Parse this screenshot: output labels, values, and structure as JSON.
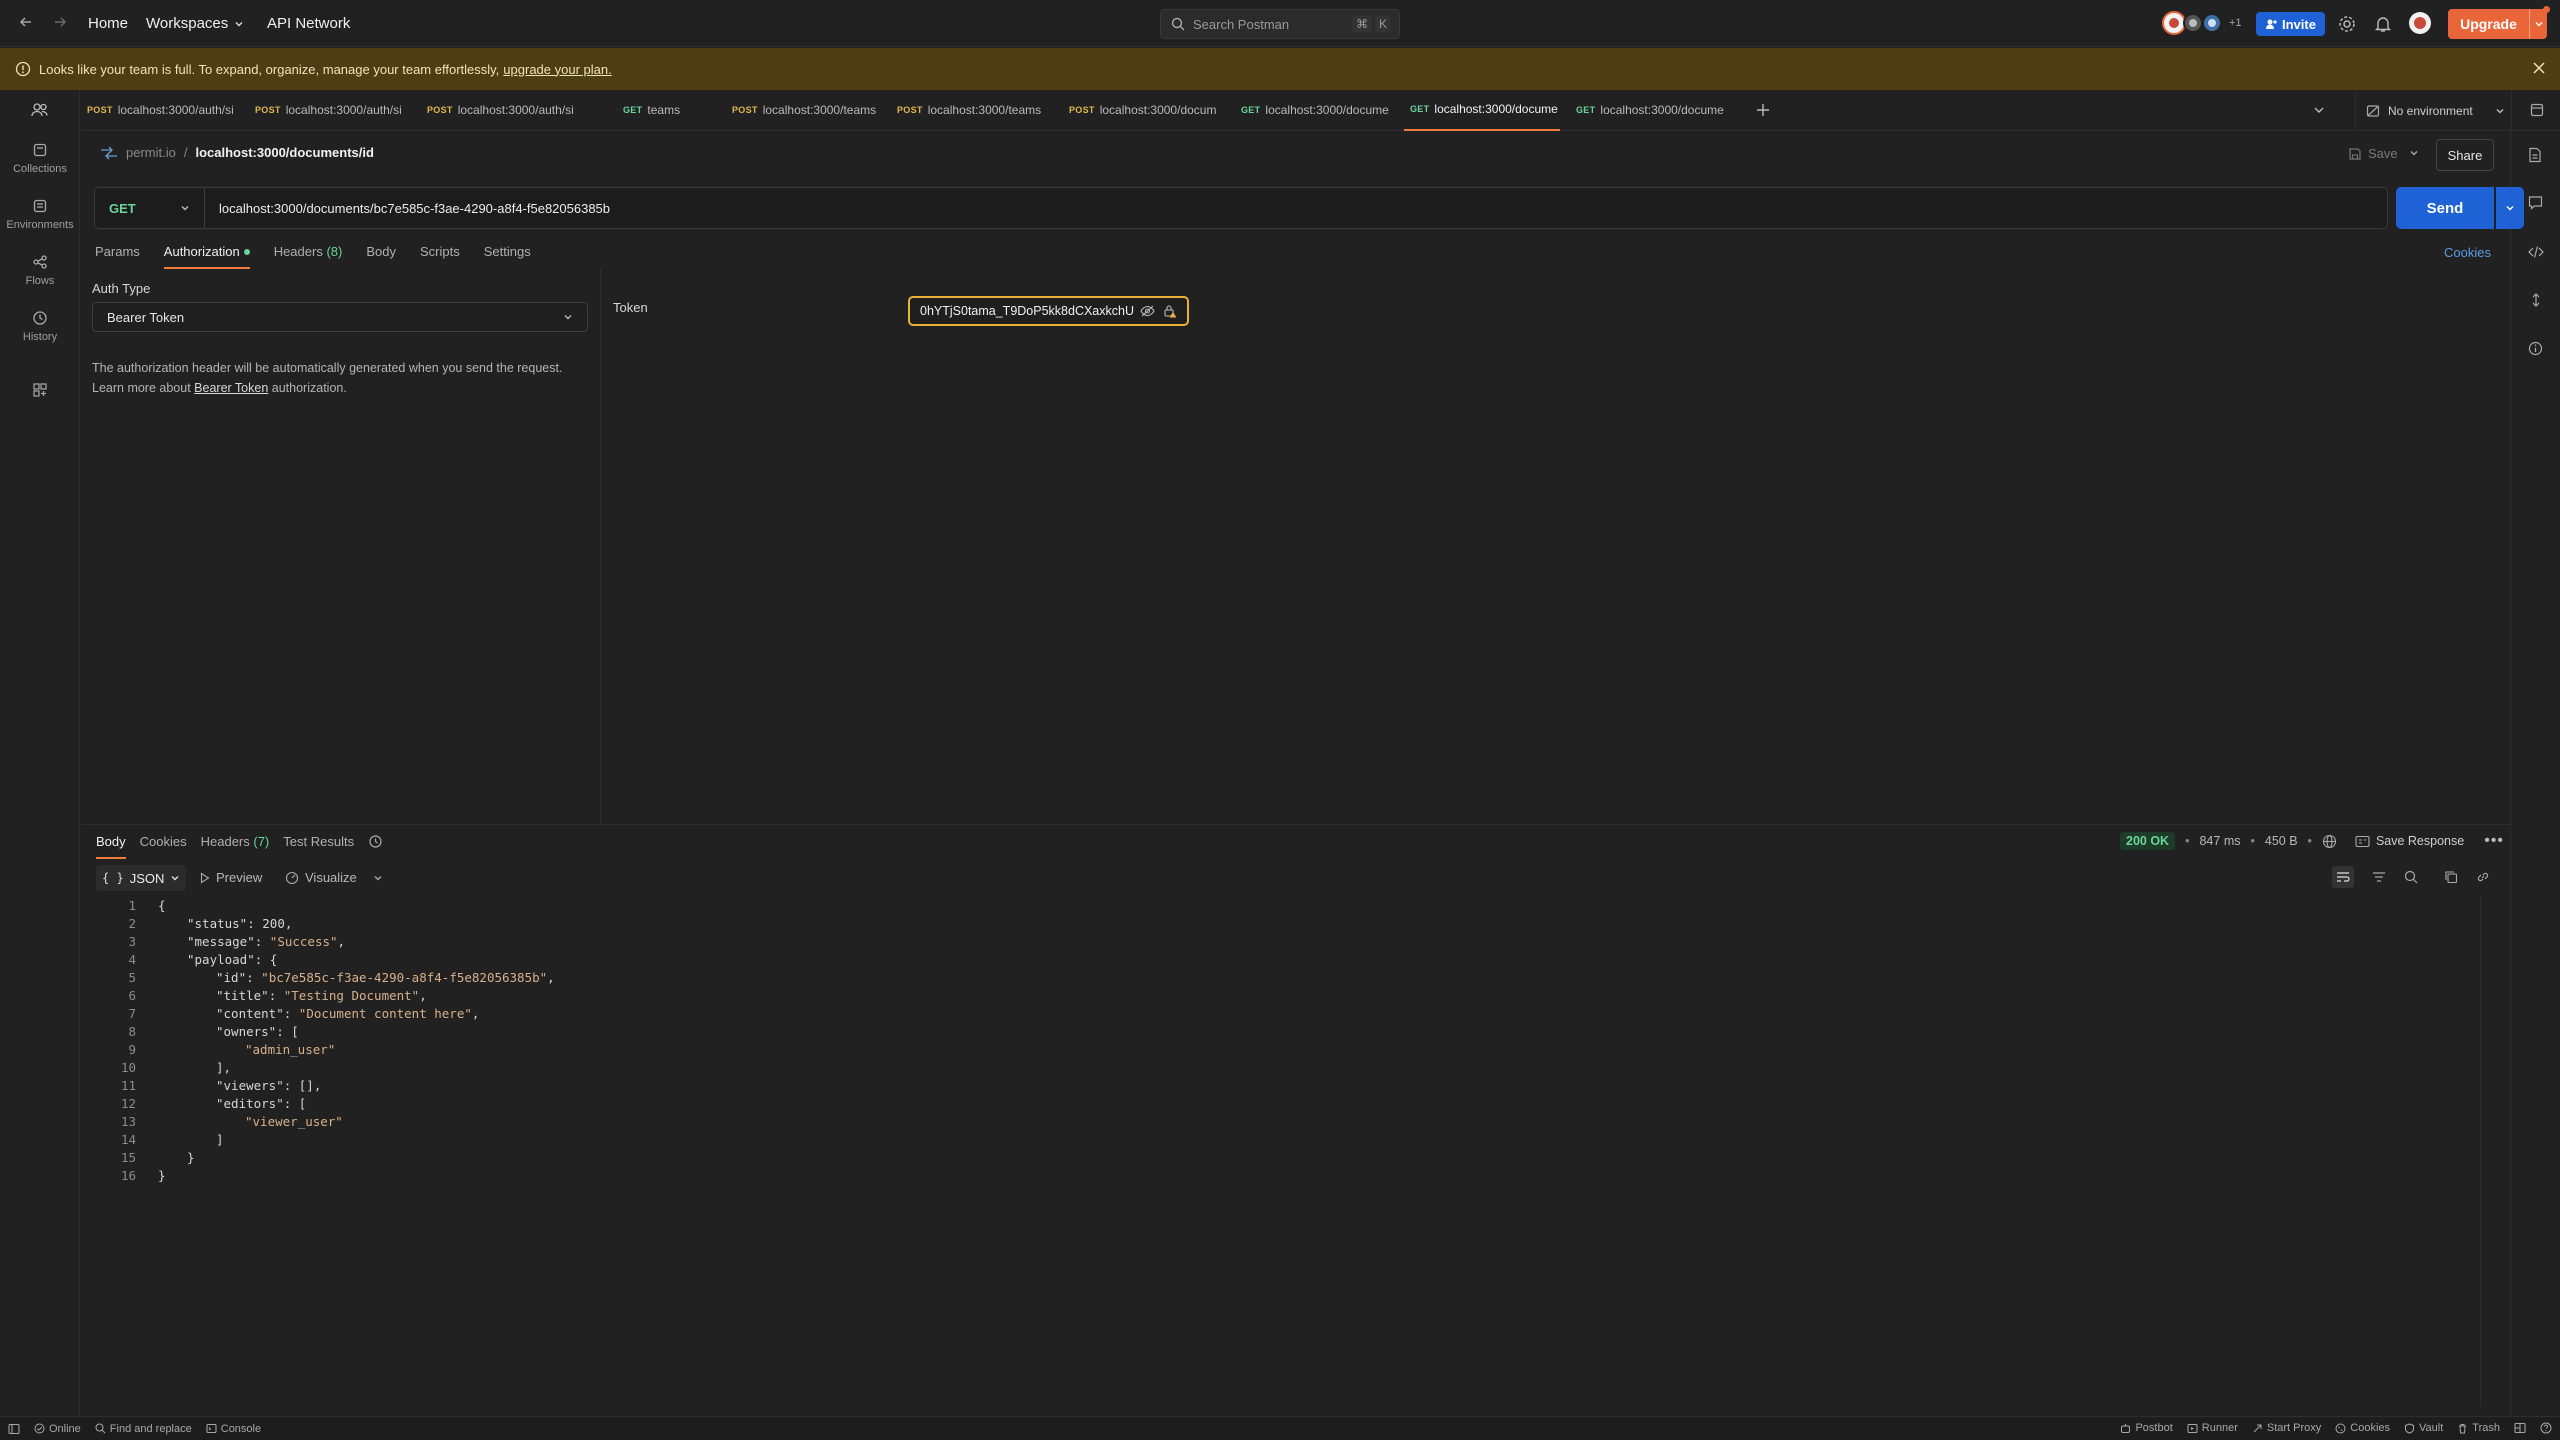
{
  "topnav": {
    "home": "Home",
    "workspaces": "Workspaces",
    "api_network": "API Network",
    "search_placeholder": "Search Postman",
    "shortcut_cmd": "⌘",
    "shortcut_key": "K",
    "avatars_extra": "+1",
    "invite": "Invite",
    "upgrade": "Upgrade"
  },
  "banner": {
    "text": "Looks like your team is full. To expand, organize, manage your team effortlessly,",
    "link": "upgrade your plan."
  },
  "rail": [
    {
      "label": "",
      "icon": "team-icon"
    },
    {
      "label": "Collections",
      "icon": "collections-icon"
    },
    {
      "label": "Environments",
      "icon": "environments-icon"
    },
    {
      "label": "Flows",
      "icon": "flows-icon"
    },
    {
      "label": "History",
      "icon": "history-icon"
    },
    {
      "label": "",
      "icon": "apps-icon"
    }
  ],
  "tabs": [
    {
      "method": "POST",
      "label": "localhost:3000/auth/si"
    },
    {
      "method": "POST",
      "label": "localhost:3000/auth/si"
    },
    {
      "method": "POST",
      "label": "localhost:3000/auth/si"
    },
    {
      "method": "GET",
      "label": "teams"
    },
    {
      "method": "POST",
      "label": "localhost:3000/teams"
    },
    {
      "method": "POST",
      "label": "localhost:3000/teams"
    },
    {
      "method": "POST",
      "label": "localhost:3000/docum"
    },
    {
      "method": "GET",
      "label": "localhost:3000/docume"
    },
    {
      "method": "GET",
      "label": "localhost:3000/docume"
    },
    {
      "method": "GET",
      "label": "localhost:3000/docume"
    }
  ],
  "environment": "No environment",
  "breadcrumb": {
    "parent": "permit.io",
    "sep": "/",
    "current": "localhost:3000/documents/id"
  },
  "save": "Save",
  "share": "Share",
  "request": {
    "method": "GET",
    "url": "localhost:3000/documents/bc7e585c-f3ae-4290-a8f4-f5e82056385b",
    "send": "Send"
  },
  "req_tabs": {
    "params": "Params",
    "authorization": "Authorization",
    "headers": "Headers",
    "headers_count": "(8)",
    "body": "Body",
    "scripts": "Scripts",
    "settings": "Settings",
    "cookies": "Cookies"
  },
  "auth": {
    "type_label": "Auth Type",
    "type_value": "Bearer Token",
    "desc1": "The authorization header will be automatically generated when you send the request.",
    "desc2_pre": "Learn more about",
    "desc2_link": "Bearer Token",
    "desc2_post": "authorization.",
    "token_label": "Token",
    "token_value": "0hYTjS0tama_T9DoP5kk8dCXaxkchU"
  },
  "resp_tabs": {
    "body": "Body",
    "cookies": "Cookies",
    "headers": "Headers",
    "headers_count": "(7)",
    "test_results": "Test Results"
  },
  "resp_meta": {
    "status": "200 OK",
    "time": "847 ms",
    "size": "450 B",
    "save_response": "Save Response"
  },
  "resp_toolbar": {
    "format": "JSON",
    "preview": "Preview",
    "visualize": "Visualize"
  },
  "code_lines": [
    {
      "n": "1",
      "indent": 0,
      "parts": [
        [
          "p",
          "{"
        ]
      ]
    },
    {
      "n": "2",
      "indent": 1,
      "parts": [
        [
          "k",
          "\"status\""
        ],
        [
          "p",
          ": "
        ],
        [
          "n",
          "200"
        ],
        [
          "p",
          ","
        ]
      ]
    },
    {
      "n": "3",
      "indent": 1,
      "parts": [
        [
          "k",
          "\"message\""
        ],
        [
          "p",
          ": "
        ],
        [
          "s",
          "\"Success\""
        ],
        [
          "p",
          ","
        ]
      ]
    },
    {
      "n": "4",
      "indent": 1,
      "parts": [
        [
          "k",
          "\"payload\""
        ],
        [
          "p",
          ": {"
        ]
      ]
    },
    {
      "n": "5",
      "indent": 2,
      "parts": [
        [
          "k",
          "\"id\""
        ],
        [
          "p",
          ": "
        ],
        [
          "s",
          "\"bc7e585c-f3ae-4290-a8f4-f5e82056385b\""
        ],
        [
          "p",
          ","
        ]
      ]
    },
    {
      "n": "6",
      "indent": 2,
      "parts": [
        [
          "k",
          "\"title\""
        ],
        [
          "p",
          ": "
        ],
        [
          "s",
          "\"Testing Document\""
        ],
        [
          "p",
          ","
        ]
      ]
    },
    {
      "n": "7",
      "indent": 2,
      "parts": [
        [
          "k",
          "\"content\""
        ],
        [
          "p",
          ": "
        ],
        [
          "s",
          "\"Document content here\""
        ],
        [
          "p",
          ","
        ]
      ]
    },
    {
      "n": "8",
      "indent": 2,
      "parts": [
        [
          "k",
          "\"owners\""
        ],
        [
          "p",
          ": ["
        ]
      ]
    },
    {
      "n": "9",
      "indent": 3,
      "parts": [
        [
          "s",
          "\"admin_user\""
        ]
      ]
    },
    {
      "n": "10",
      "indent": 2,
      "parts": [
        [
          "p",
          "],"
        ]
      ]
    },
    {
      "n": "11",
      "indent": 2,
      "parts": [
        [
          "k",
          "\"viewers\""
        ],
        [
          "p",
          ": [],"
        ]
      ]
    },
    {
      "n": "12",
      "indent": 2,
      "parts": [
        [
          "k",
          "\"editors\""
        ],
        [
          "p",
          ": ["
        ]
      ]
    },
    {
      "n": "13",
      "indent": 3,
      "parts": [
        [
          "s",
          "\"viewer_user\""
        ]
      ]
    },
    {
      "n": "14",
      "indent": 2,
      "parts": [
        [
          "p",
          "]"
        ]
      ]
    },
    {
      "n": "15",
      "indent": 1,
      "parts": [
        [
          "p",
          "}"
        ]
      ]
    },
    {
      "n": "16",
      "indent": 0,
      "parts": [
        [
          "p",
          "}"
        ]
      ]
    }
  ],
  "statusbar": {
    "online": "Online",
    "find_replace": "Find and replace",
    "console": "Console",
    "postbot": "Postbot",
    "runner": "Runner",
    "start_proxy": "Start Proxy",
    "cookies": "Cookies",
    "vault": "Vault",
    "trash": "Trash"
  }
}
